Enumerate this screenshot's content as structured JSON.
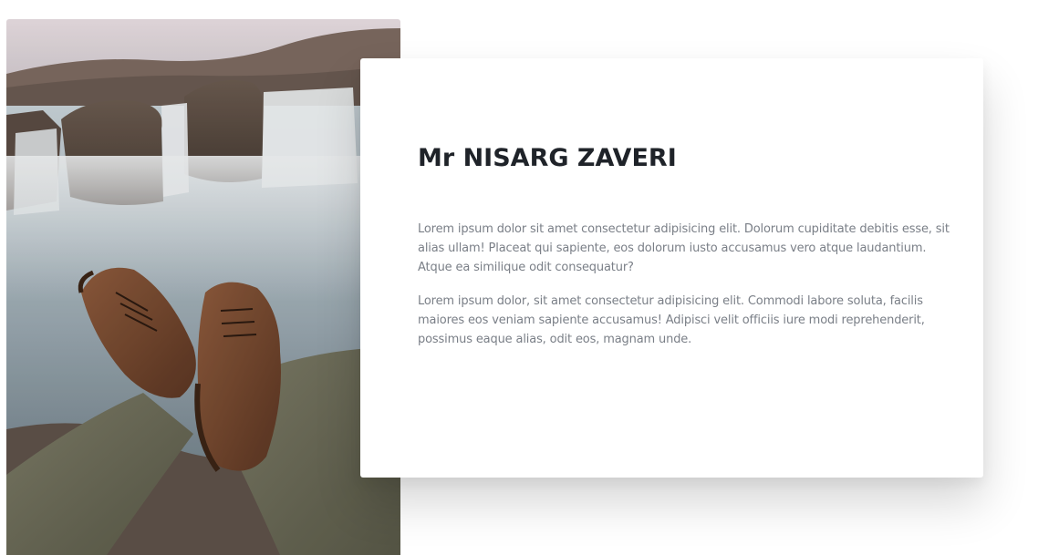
{
  "profile": {
    "title": "Mr NISARG ZAVERI",
    "paragraphs": [
      "Lorem ipsum dolor sit amet consectetur adipisicing elit. Dolorum cupiditate debitis esse, sit alias ullam! Placeat qui sapiente, eos dolorum iusto accusamus vero atque laudantium. Atque ea similique odit consequatur?",
      "Lorem ipsum dolor, sit amet consectetur adipisicing elit. Commodi labore soluta, facilis maiores eos veniam sapiente accusamus! Adipisci velit officiis iure modi reprehenderit, possimus eaque alias, odit eos, magnam unde."
    ]
  },
  "colors": {
    "title": "#1f2329",
    "body_text": "#7a7f87",
    "card_background": "#ffffff",
    "page_background": "#ffffff"
  },
  "image": {
    "subject": "feet-over-waterfall-photo"
  }
}
